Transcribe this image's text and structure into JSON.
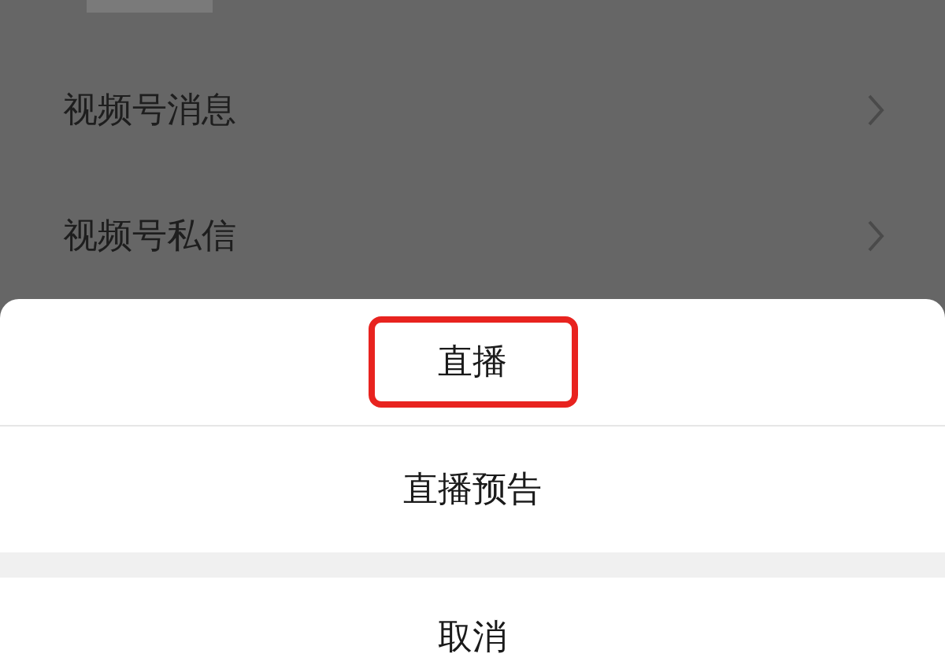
{
  "background_list": {
    "items": [
      {
        "label": "视频号消息"
      },
      {
        "label": "视频号私信"
      }
    ]
  },
  "action_sheet": {
    "options": [
      {
        "label": "直播",
        "highlighted": true
      },
      {
        "label": "直播预告",
        "highlighted": false
      }
    ],
    "cancel": "取消"
  }
}
